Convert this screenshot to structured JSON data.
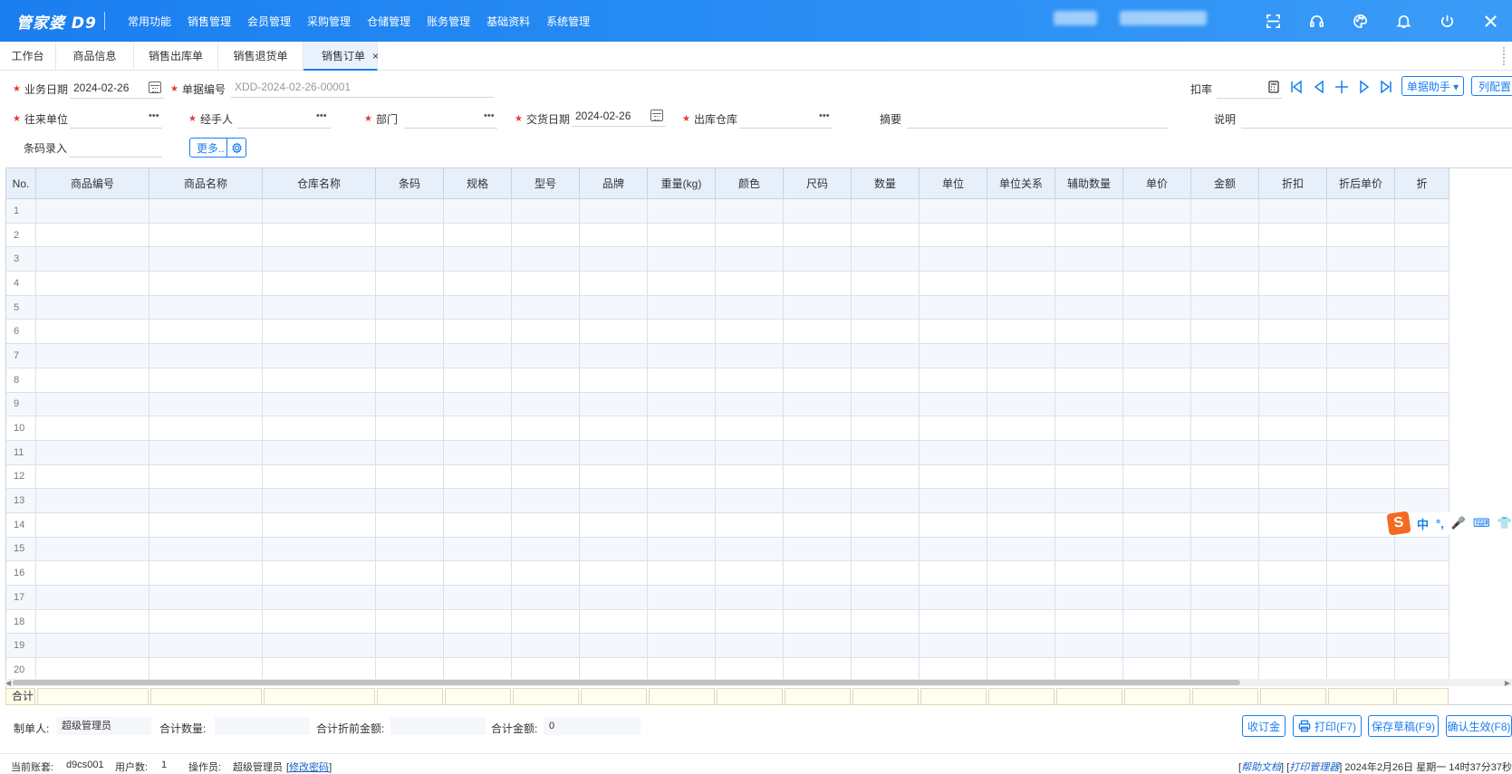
{
  "app": {
    "logo": "管家婆 D9",
    "menu": [
      "常用功能",
      "销售管理",
      "会员管理",
      "采购管理",
      "仓储管理",
      "账务管理",
      "基础资料",
      "系统管理"
    ]
  },
  "topbar_icons": [
    "scan-icon",
    "headset-icon",
    "palette-icon",
    "bell-icon",
    "power-icon",
    "close-icon"
  ],
  "tabs": [
    {
      "label": "工作台"
    },
    {
      "label": "商品信息"
    },
    {
      "label": "销售出库单"
    },
    {
      "label": "销售退货单"
    },
    {
      "label": "销售订单",
      "active": true,
      "close": "×"
    }
  ],
  "form": {
    "biz_date_label": "业务日期",
    "biz_date": "2024-02-26",
    "bill_no_label": "单据编号",
    "bill_no": "XDD-2024-02-26-00001",
    "discount_label": "扣率",
    "bill_helper": "单据助手 ▾",
    "col_config": "列配置",
    "partner_label": "往来单位",
    "handler_label": "经手人",
    "dept_label": "部门",
    "delivery_date_label": "交货日期",
    "delivery_date": "2024-02-26",
    "warehouse_label": "出库仓库",
    "summary_label": "摘要",
    "remark_label": "说明",
    "barcode_label": "条码录入",
    "more_button": "更多..",
    "ellipsis": "•••"
  },
  "grid": {
    "columns": [
      "No.",
      "商品编号",
      "商品名称",
      "仓库名称",
      "条码",
      "规格",
      "型号",
      "品牌",
      "重量(kg)",
      "颜色",
      "尺码",
      "数量",
      "单位",
      "单位关系",
      "辅助数量",
      "单价",
      "金额",
      "折扣",
      "折后单价",
      "折"
    ],
    "rows": [
      "1",
      "2",
      "3",
      "4",
      "5",
      "6",
      "7",
      "8",
      "9",
      "10",
      "11",
      "12",
      "13",
      "14",
      "15",
      "16",
      "17",
      "18",
      "19",
      "20"
    ],
    "total_label": "合计"
  },
  "footer": {
    "maker_label": "制单人:",
    "maker": "超级管理员",
    "total_qty_label": "合计数量:",
    "total_qty": "",
    "total_pre_label": "合计折前金额:",
    "total_pre": "",
    "total_amt_label": "合计金额:",
    "total_amt": "0",
    "btn_deposit": "收订金",
    "btn_print": "打印(F7)",
    "btn_draft": "保存草稿(F9)",
    "btn_confirm": "确认生效(F8)"
  },
  "status": {
    "account_label": "当前账套:",
    "account": "d9cs001",
    "users_label": "用户数:",
    "users": "1",
    "operator_label": "操作员:",
    "operator": "超级管理员",
    "change_pwd": "修改密码",
    "help_doc": "帮助文档",
    "print_mgr": "打印管理器",
    "datetime": "2024年2月26日 星期一  14时37分37秒"
  },
  "ime": {
    "logo": "S",
    "items": [
      "中",
      "°,",
      "🎤",
      "⌨",
      "👕"
    ]
  }
}
